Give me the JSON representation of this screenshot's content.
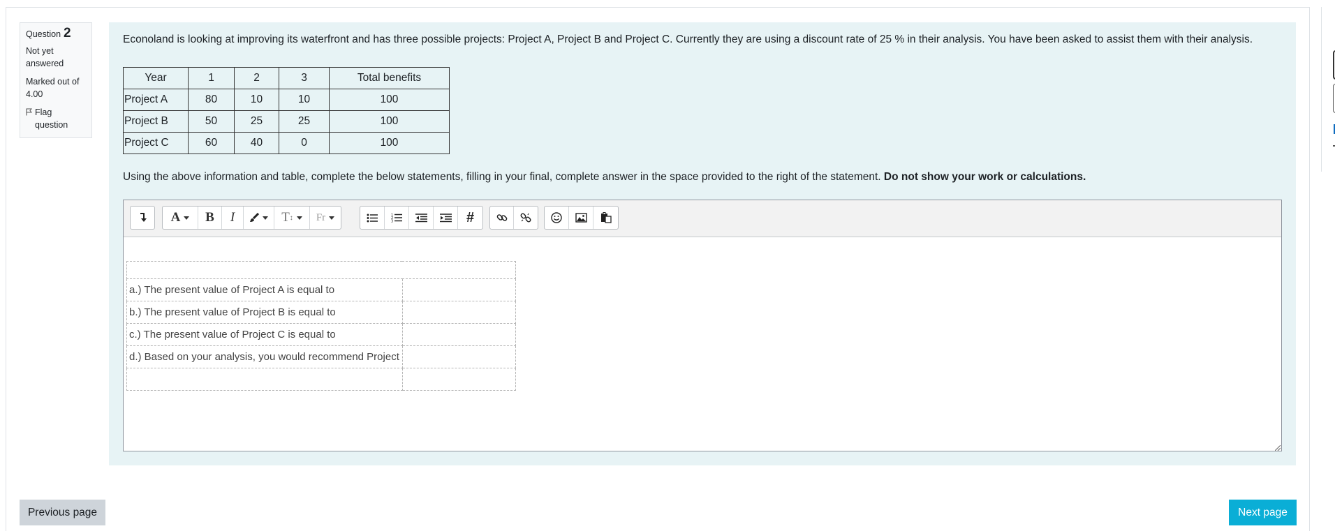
{
  "question_info": {
    "label": "Question",
    "number": "2",
    "state": "Not yet answered",
    "marks": "Marked out of 4.00",
    "flag_label": "Flag question"
  },
  "question_text": "Econoland is looking at improving its waterfront and has three possible projects: Project A, Project B and Project C.  Currently they are using a discount rate of 25 % in their analysis.   You have been asked to assist them with their analysis.",
  "benefits_table": {
    "headers": [
      "Year",
      "1",
      "2",
      "3",
      "Total benefits"
    ],
    "rows": [
      [
        "Project A",
        "80",
        "10",
        "10",
        "100"
      ],
      [
        "Project B",
        "50",
        "25",
        "25",
        "100"
      ],
      [
        "Project C",
        "60",
        "40",
        "0",
        "100"
      ]
    ]
  },
  "instructions": {
    "text": "Using the above information and table, complete the below statements, filling in your final, complete answer in the space provided to the right of the statement. ",
    "bold": "Do not show your work or calculations."
  },
  "editor": {
    "toolbar_icons": [
      "collapse-icon",
      "text-style-icon",
      "bold-icon",
      "italic-icon",
      "font-color-icon",
      "font-size-icon",
      "font-family-icon",
      "unordered-list-icon",
      "ordered-list-icon",
      "outdent-icon",
      "indent-icon",
      "equation-icon",
      "link-icon",
      "unlink-icon",
      "emoji-icon",
      "image-icon",
      "paste-icon"
    ],
    "statements": [
      "a.) The present value of Project A is equal to",
      "b.) The present value of Project B is equal to",
      "c.) The present value of Project C is equal to",
      "d.) Based on your analysis, you would recommend Project"
    ]
  },
  "navigation": {
    "previous": "Previous page",
    "next": "Next page"
  },
  "colors": {
    "panel_bg": "#e7f3f5",
    "next_button": "#0aaed6",
    "prev_button": "#ced4da"
  }
}
